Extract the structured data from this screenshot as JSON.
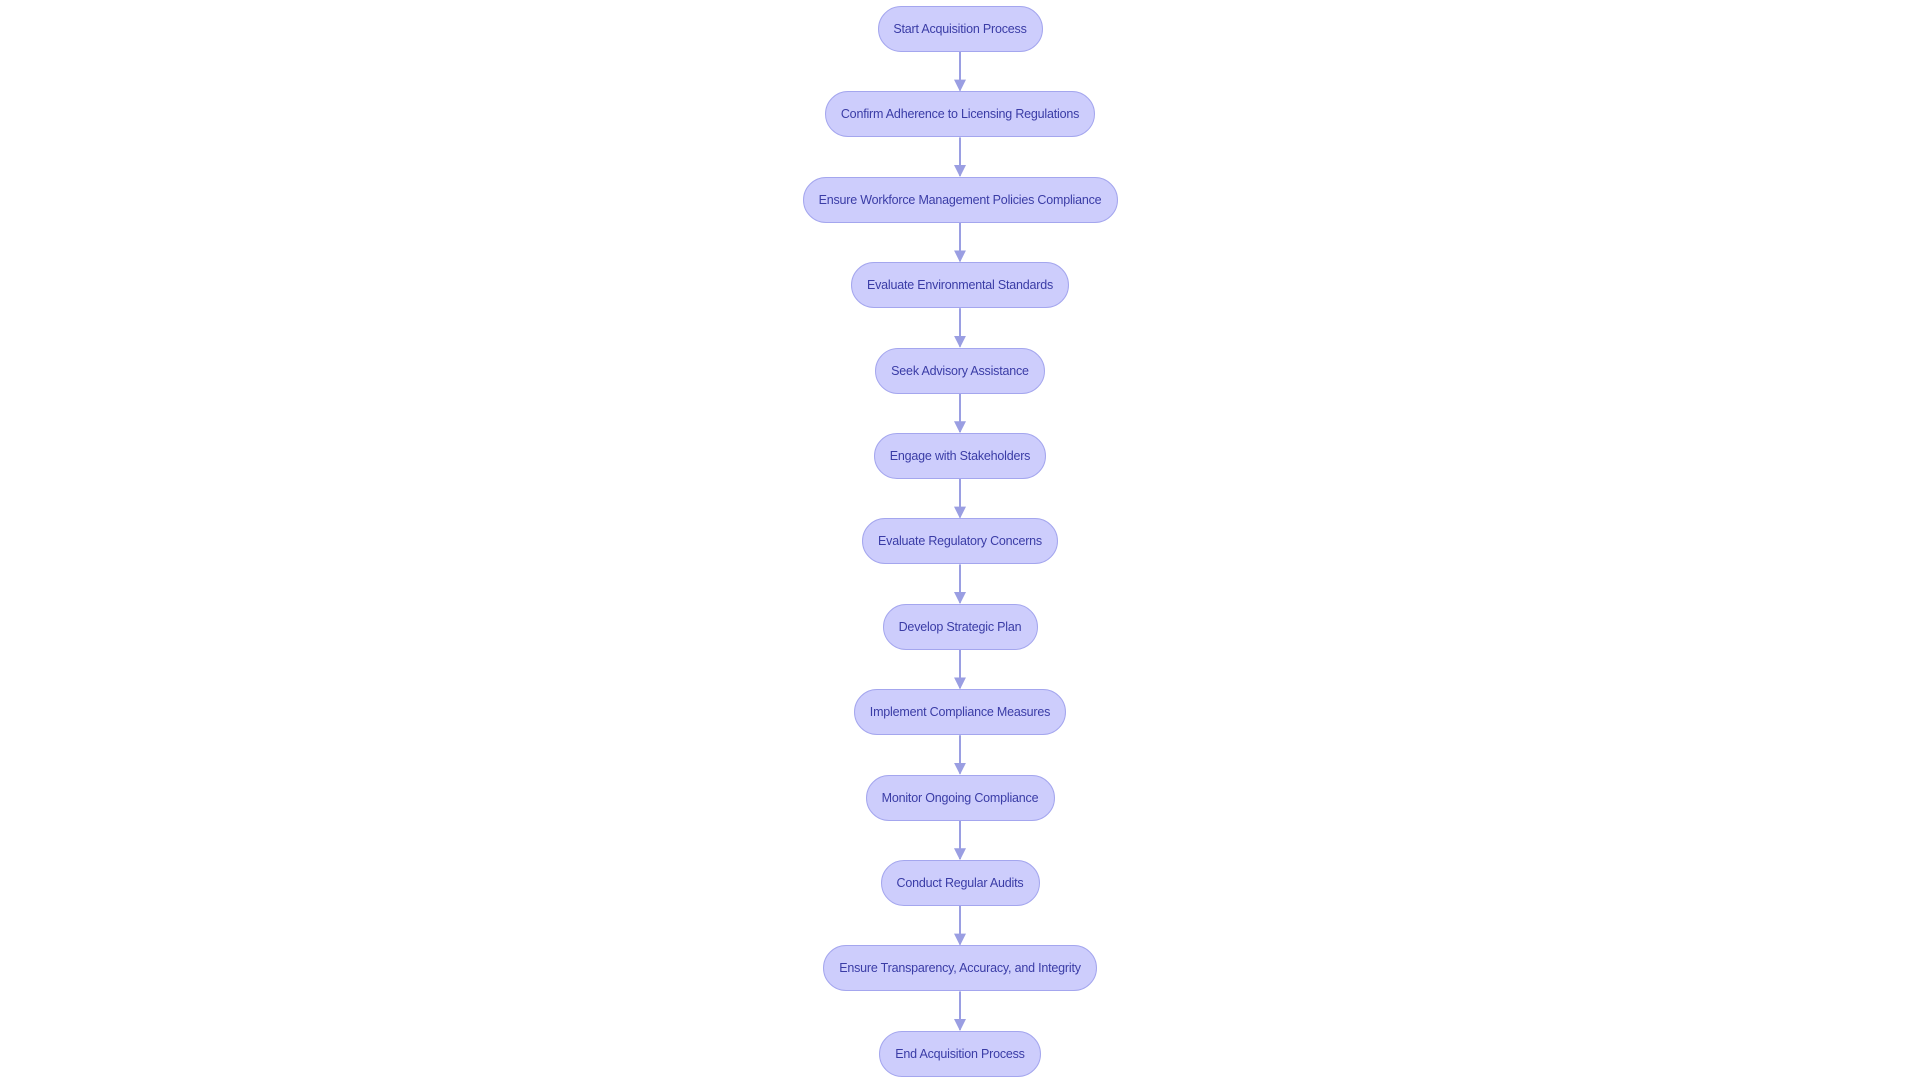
{
  "diagram": {
    "type": "flowchart",
    "direction": "top-to-bottom",
    "colors": {
      "node_fill": "#cdcdfc",
      "node_border": "#a4a6ee",
      "node_text": "#3a3ca6",
      "edge": "#9a9ee2",
      "background": "#ffffff"
    },
    "nodes": [
      {
        "id": "n1",
        "label": "Start Acquisition Process"
      },
      {
        "id": "n2",
        "label": "Confirm Adherence to Licensing Regulations"
      },
      {
        "id": "n3",
        "label": "Ensure Workforce Management Policies Compliance"
      },
      {
        "id": "n4",
        "label": "Evaluate Environmental Standards"
      },
      {
        "id": "n5",
        "label": "Seek Advisory Assistance"
      },
      {
        "id": "n6",
        "label": "Engage with Stakeholders"
      },
      {
        "id": "n7",
        "label": "Evaluate Regulatory Concerns"
      },
      {
        "id": "n8",
        "label": "Develop Strategic Plan"
      },
      {
        "id": "n9",
        "label": "Implement Compliance Measures"
      },
      {
        "id": "n10",
        "label": "Monitor Ongoing Compliance"
      },
      {
        "id": "n11",
        "label": "Conduct Regular Audits"
      },
      {
        "id": "n12",
        "label": "Ensure Transparency, Accuracy, and Integrity"
      },
      {
        "id": "n13",
        "label": "End Acquisition Process"
      }
    ],
    "edges": [
      {
        "from": "n1",
        "to": "n2"
      },
      {
        "from": "n2",
        "to": "n3"
      },
      {
        "from": "n3",
        "to": "n4"
      },
      {
        "from": "n4",
        "to": "n5"
      },
      {
        "from": "n5",
        "to": "n6"
      },
      {
        "from": "n6",
        "to": "n7"
      },
      {
        "from": "n7",
        "to": "n8"
      },
      {
        "from": "n8",
        "to": "n9"
      },
      {
        "from": "n9",
        "to": "n10"
      },
      {
        "from": "n10",
        "to": "n11"
      },
      {
        "from": "n11",
        "to": "n12"
      },
      {
        "from": "n12",
        "to": "n13"
      }
    ]
  }
}
